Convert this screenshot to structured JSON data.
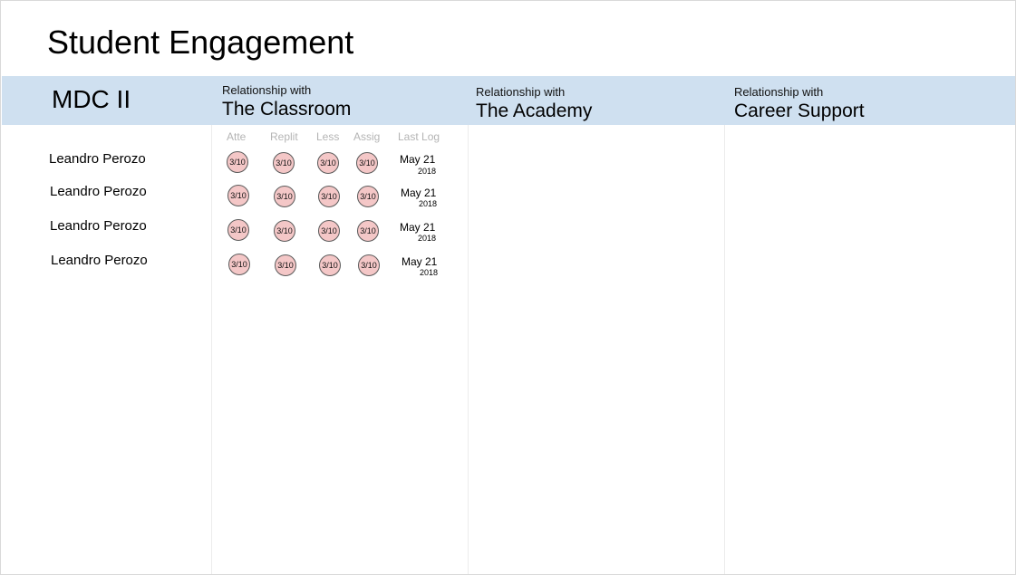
{
  "page": {
    "title": "Student Engagement",
    "cohort": "MDC II"
  },
  "sections": [
    {
      "prefix": "Relationship with",
      "title": "The Classroom"
    },
    {
      "prefix": "Relationship with",
      "title": "The Academy"
    },
    {
      "prefix": "Relationship with",
      "title": "Career Support"
    }
  ],
  "classroom_columns": [
    "Atte",
    "Replit",
    "Less",
    "Assig",
    "Last Log"
  ],
  "students": [
    {
      "name": "Leandro Perozo",
      "scores": [
        "3/10",
        "3/10",
        "3/10",
        "3/10"
      ],
      "last_log": {
        "date": "May 21",
        "year": "2018"
      }
    },
    {
      "name": "Leandro Perozo",
      "scores": [
        "3/10",
        "3/10",
        "3/10",
        "3/10"
      ],
      "last_log": {
        "date": "May 21",
        "year": "2018"
      }
    },
    {
      "name": "Leandro Perozo",
      "scores": [
        "3/10",
        "3/10",
        "3/10",
        "3/10"
      ],
      "last_log": {
        "date": "May 21",
        "year": "2018"
      }
    },
    {
      "name": "Leandro Perozo",
      "scores": [
        "3/10",
        "3/10",
        "3/10",
        "3/10"
      ],
      "last_log": {
        "date": "May 21",
        "year": "2018"
      }
    }
  ],
  "colors": {
    "header_band": "#cfe0f0",
    "score_badge": "#f4c7c7",
    "column_header_text": "#b4b4b4"
  }
}
